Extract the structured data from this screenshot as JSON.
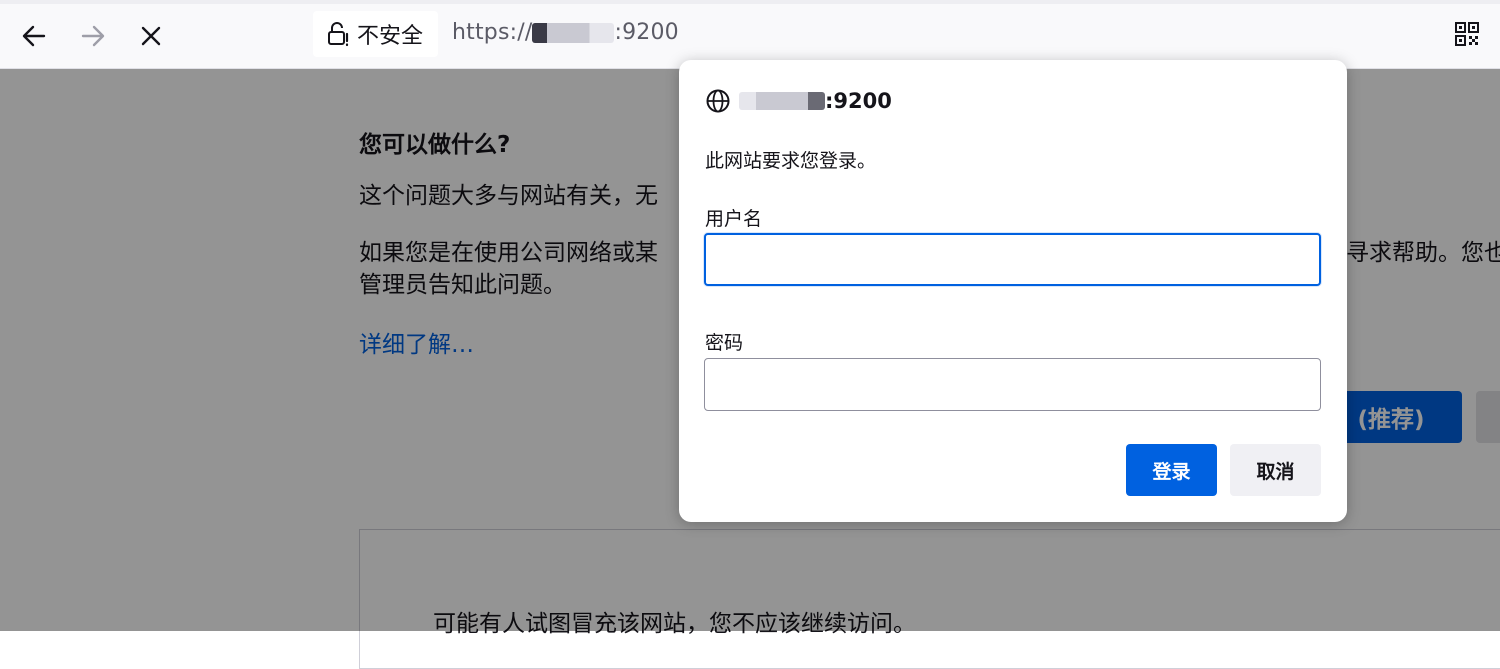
{
  "toolbar": {
    "security_label": "不安全",
    "url_prefix": "https://",
    "url_suffix": ":9200",
    "icons": [
      "back-arrow-icon",
      "forward-arrow-icon",
      "stop-icon",
      "insecure-lock-icon",
      "qr-code-icon"
    ]
  },
  "page": {
    "heading": "您可以做什么?",
    "para1": "这个问题大多与网站有关，无",
    "para2_line1": "如果您是在使用公司网络或某",
    "para2_tail": "寻求帮助。您也",
    "para2_line2": "管理员告知此问题。",
    "learn_more": "详细了解…",
    "recommend_button": "(推荐)",
    "detail_text": "可能有人试图冒充该网站，您不应该继续访问。"
  },
  "dialog": {
    "origin_suffix": ":9200",
    "message": "此网站要求您登录。",
    "username_label": "用户名",
    "username_value": "",
    "password_label": "密码",
    "password_value": "",
    "login_button": "登录",
    "cancel_button": "取消"
  },
  "colors": {
    "accent": "#0061e0",
    "text": "#15141a",
    "toolbar_bg": "#f9f9fb"
  }
}
